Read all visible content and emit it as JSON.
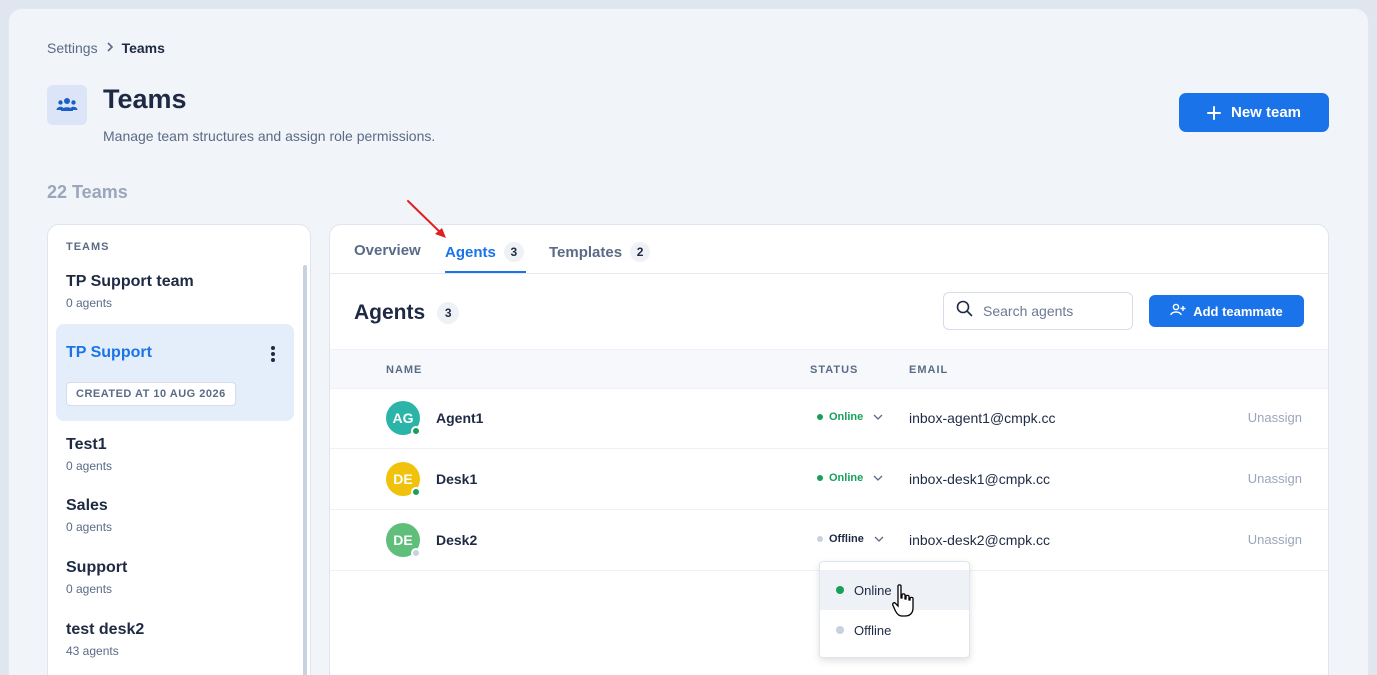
{
  "breadcrumb": {
    "parent": "Settings",
    "current": "Teams"
  },
  "header": {
    "title": "Teams",
    "subtitle": "Manage team structures and assign role permissions.",
    "new_team_label": "New team"
  },
  "teams_count": "22 Teams",
  "sidebar": {
    "heading": "TEAMS",
    "teams": [
      {
        "name": "TP Support team",
        "sub": "0 agents"
      },
      {
        "name": "TP Support",
        "created": "CREATED AT 10 AUG 2026"
      },
      {
        "name": "Test1",
        "sub": "0 agents"
      },
      {
        "name": "Sales",
        "sub": "0 agents"
      },
      {
        "name": "Support",
        "sub": "0 agents"
      },
      {
        "name": "test desk2",
        "sub": "43 agents"
      }
    ]
  },
  "tabs": [
    {
      "label": "Overview"
    },
    {
      "label": "Agents",
      "count": "3"
    },
    {
      "label": "Templates",
      "count": "2"
    }
  ],
  "agents_panel": {
    "title": "Agents",
    "count": "3",
    "search_placeholder": "Search agents",
    "add_label": "Add teammate",
    "columns": {
      "name": "NAME",
      "status": "STATUS",
      "email": "EMAIL"
    },
    "rows": [
      {
        "initials": "AG",
        "name": "Agent1",
        "status": "Online",
        "email": "inbox-agent1@cmpk.cc",
        "action": "Unassign",
        "avatar_color": "#2bb5a8"
      },
      {
        "initials": "DE",
        "name": "Desk1",
        "status": "Online",
        "email": "inbox-desk1@cmpk.cc",
        "action": "Unassign",
        "avatar_color": "#f0c20c"
      },
      {
        "initials": "DE",
        "name": "Desk2",
        "status": "Offline",
        "email": "inbox-desk2@cmpk.cc",
        "action": "Unassign",
        "avatar_color": "#5fbf7a"
      }
    ]
  },
  "status_dropdown": {
    "options": [
      "Online",
      "Offline"
    ],
    "hovered": "Online"
  },
  "colors": {
    "accent": "#1a73e8",
    "online": "#16a05a",
    "offline": "#c8d1de",
    "annotation_arrow": "#e02020"
  },
  "icons": [
    "users-icon",
    "plus-icon",
    "chevron-right-icon",
    "search-icon",
    "add-user-icon",
    "chevron-down-icon",
    "kebab-icon",
    "hand-cursor-icon"
  ]
}
